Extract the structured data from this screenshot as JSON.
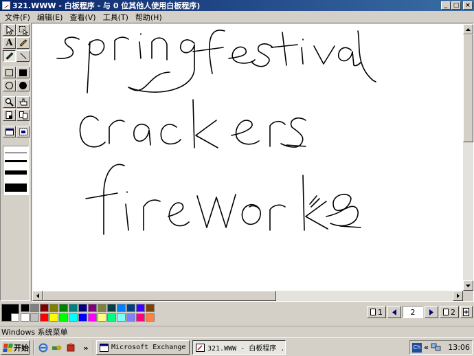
{
  "window": {
    "title": "321.WWW - 白板程序 - 与 0 位其他人使用白板程序)",
    "buttons": {
      "minimize": "_",
      "maximize": "□",
      "close": "×"
    }
  },
  "menu": [
    "文件(F)",
    "编辑(E)",
    "查看(V)",
    "工具(T)",
    "帮助(H)"
  ],
  "toolbox": {
    "tools": [
      {
        "name": "select-arrow",
        "icon": "arrow-icon"
      },
      {
        "name": "select-area",
        "icon": "marquee-icon"
      },
      {
        "name": "text-tool",
        "icon": "text-a-icon",
        "glyph": "A"
      },
      {
        "name": "highlighter-tool",
        "icon": "highlighter-icon"
      },
      {
        "name": "pen-tool",
        "icon": "pen-icon",
        "active": true
      },
      {
        "name": "line-tool",
        "icon": "line-icon"
      },
      {
        "name": "rect-outline-tool",
        "icon": "rectangle-icon"
      },
      {
        "name": "rect-fill-tool",
        "icon": "filled-rectangle-icon"
      },
      {
        "name": "ellipse-outline-tool",
        "icon": "ellipse-icon"
      },
      {
        "name": "ellipse-fill-tool",
        "icon": "filled-ellipse-icon"
      },
      {
        "name": "zoom-tool",
        "icon": "magnifier-icon"
      },
      {
        "name": "remote-pointer-tool",
        "icon": "hand-icon"
      },
      {
        "name": "lock-contents-tool",
        "icon": "lock-page-icon"
      },
      {
        "name": "sync-tool",
        "icon": "sync-pages-icon"
      },
      {
        "name": "select-window-tool",
        "icon": "select-window-icon"
      },
      {
        "name": "select-area-capture-tool",
        "icon": "capture-area-icon"
      }
    ],
    "line_widths": [
      1,
      3,
      6,
      12
    ]
  },
  "palette": {
    "current_foreground": "#000000",
    "current_background": "#ffffff",
    "colors": [
      "#000000",
      "#808080",
      "#800000",
      "#808000",
      "#008000",
      "#008080",
      "#000080",
      "#800080",
      "#808040",
      "#004040",
      "#0080ff",
      "#004080",
      "#4000ff",
      "#804000",
      "#ffffff",
      "#c0c0c0",
      "#ff0000",
      "#ffff00",
      "#00ff00",
      "#00ffff",
      "#0000ff",
      "#ff00ff",
      "#ffff80",
      "#00ff80",
      "#80ffff",
      "#8080ff",
      "#ff0080",
      "#ff8040"
    ]
  },
  "page_nav": {
    "first_label": "1",
    "current_page": "2",
    "last_label": "2"
  },
  "handwriting": [
    "spring festival",
    "crackers",
    "fireworks"
  ],
  "status_text": "Windows 系统菜单",
  "taskbar": {
    "start_label": "开始",
    "quicklaunch_more": "»",
    "tasks": [
      {
        "label": "Microsoft Exchange ...",
        "icon": "exchange-icon"
      },
      {
        "label": "321.WWW - 白板程序 ...",
        "icon": "whiteboard-icon",
        "active": true
      }
    ],
    "tray": {
      "ime": "Ch",
      "chevron": "«",
      "clock": "13:06"
    }
  }
}
